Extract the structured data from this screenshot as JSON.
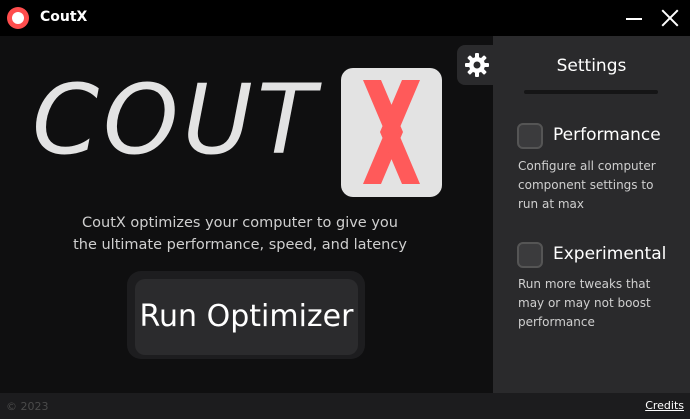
{
  "window": {
    "title": "CoutX"
  },
  "logo": {
    "word": "COUT",
    "x_letter": "X",
    "accent": "#ff5a5a"
  },
  "tagline": {
    "line1": "CoutX optimizes your computer to give you",
    "line2": "the ultimate performance, speed, and latency"
  },
  "run_button": {
    "label": "Run Optimizer"
  },
  "footer": {
    "copyright": "© 2023",
    "credits": "Credits"
  },
  "settings": {
    "title": "Settings",
    "options": [
      {
        "label": "Performance",
        "checked": false,
        "description": [
          "Configure all computer",
          "component settings to",
          "run at max"
        ]
      },
      {
        "label": "Experimental",
        "checked": false,
        "description": [
          "Run more tweaks that",
          "may or may not boost",
          "performance"
        ]
      }
    ]
  },
  "icons": {
    "app": "app-logo-icon",
    "gear": "gear-icon",
    "minimize": "minimize-icon",
    "close": "close-icon"
  }
}
